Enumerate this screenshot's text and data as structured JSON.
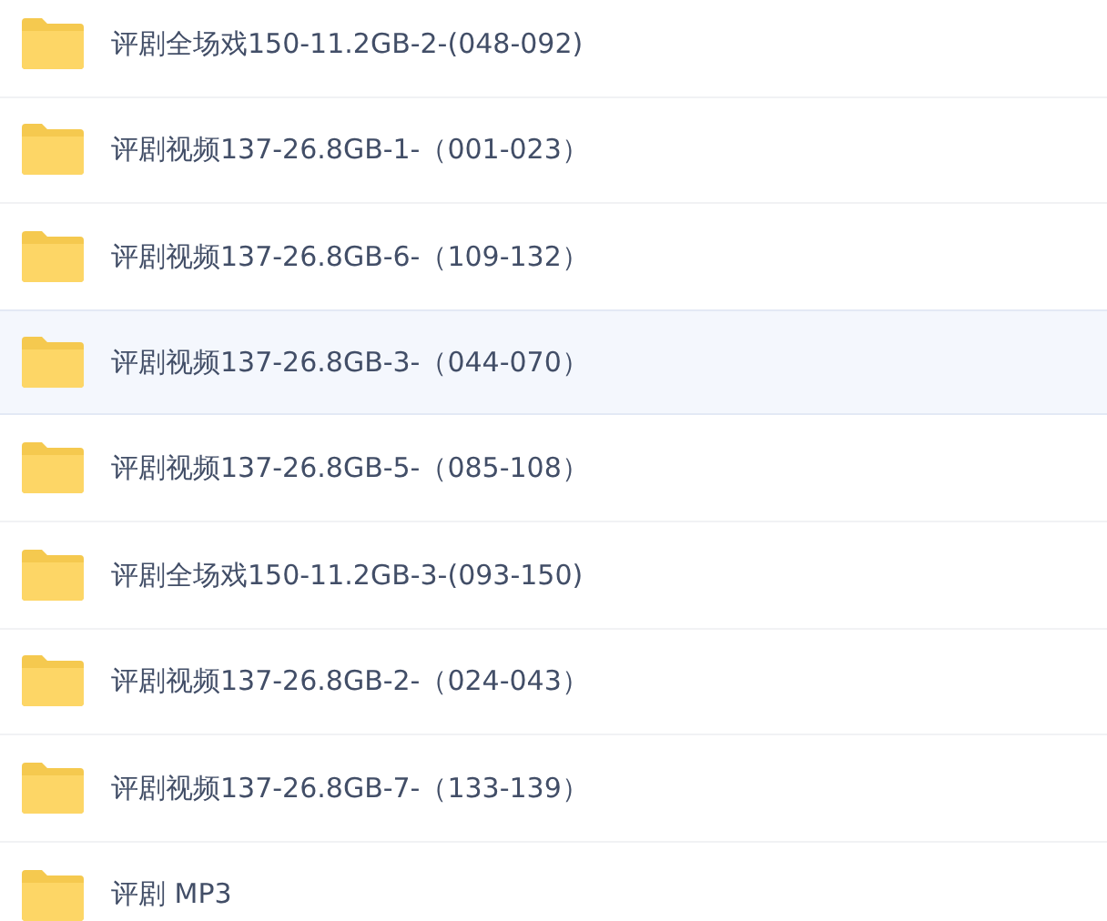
{
  "files": [
    {
      "name": "评剧全场戏150-11.2GB-2-(048-092)",
      "selected": false
    },
    {
      "name": "评剧视频137-26.8GB-1-（001-023）",
      "selected": false
    },
    {
      "name": "评剧视频137-26.8GB-6-（109-132）",
      "selected": false
    },
    {
      "name": "评剧视频137-26.8GB-3-（044-070）",
      "selected": true
    },
    {
      "name": "评剧视频137-26.8GB-5-（085-108）",
      "selected": false
    },
    {
      "name": "评剧全场戏150-11.2GB-3-(093-150)",
      "selected": false
    },
    {
      "name": "评剧视频137-26.8GB-2-（024-043）",
      "selected": false
    },
    {
      "name": "评剧视频137-26.8GB-7-（133-139）",
      "selected": false
    },
    {
      "name": "评剧 MP3",
      "selected": false
    }
  ]
}
